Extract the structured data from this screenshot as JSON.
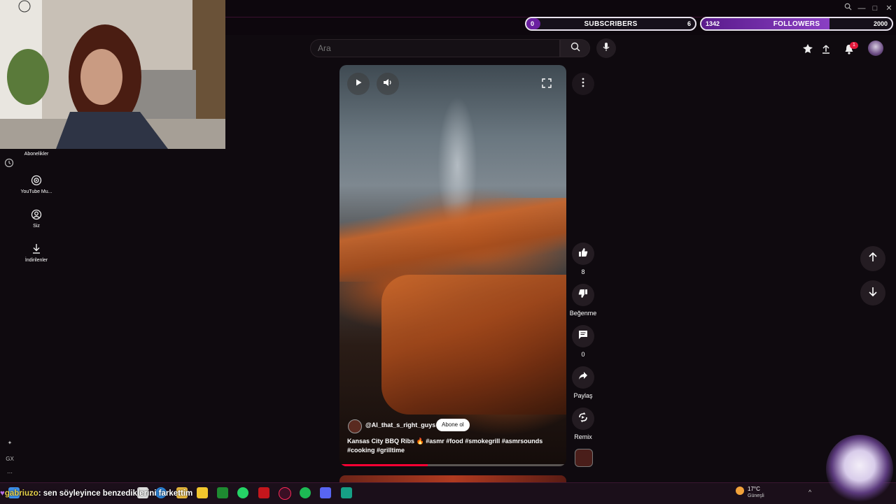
{
  "stream_overlay": {
    "subscribers": {
      "label": "SUBSCRIBERS",
      "current": "0",
      "goal": "6",
      "progress": 0.0
    },
    "followers": {
      "label": "FOLLOWERS",
      "current": "1342",
      "goal": "2000",
      "progress": 0.671
    },
    "chat": {
      "user": "gabriuzo",
      "message": ": sen söyleyince benzediklerini farkettim"
    }
  },
  "header": {
    "search_placeholder": "Ara",
    "icons": [
      "search-icon",
      "mic-icon",
      "create-icon",
      "upload-icon",
      "bell-icon"
    ],
    "notification_count": "1"
  },
  "sidebar": {
    "items": [
      {
        "label": "Abonelikler",
        "icon": "subscriptions-icon"
      },
      {
        "label": "YouTube Mu...",
        "icon": "youtube-music-icon"
      },
      {
        "label": "Siz",
        "icon": "you-icon"
      },
      {
        "label": "İndirilenler",
        "icon": "download-icon"
      }
    ],
    "bottom_labels": [
      "GX"
    ]
  },
  "short": {
    "channel": "@AI_that_s_right_guys",
    "subscribe_label": "Abone ol",
    "caption": "Kansas City BBQ Ribs 🔥 #asmr #food #smokegrill #asmrsounds #cooking #grilltime",
    "progress": 0.39
  },
  "actions": {
    "likes": "8",
    "dislike_label": "Beğenme",
    "comments": "0",
    "share_label": "Paylaş",
    "remix_label": "Remix"
  },
  "taskbar": {
    "weather_temp": "17°C",
    "weather_desc": "Güneşli"
  }
}
